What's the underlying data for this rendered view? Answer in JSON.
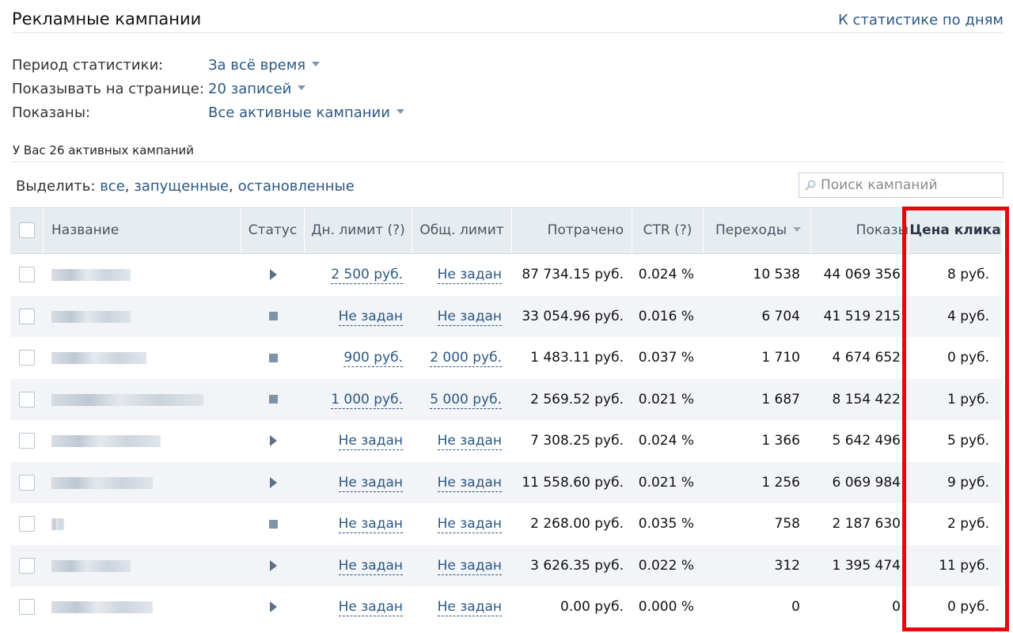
{
  "header": {
    "title": "Рекламные кампании",
    "stats_link": "К статистике по дням"
  },
  "filters": [
    {
      "label": "Период статистики:",
      "value": "За всё время"
    },
    {
      "label": "Показывать на странице:",
      "value": "20 записей"
    },
    {
      "label": "Показаны:",
      "value": "Все активные кампании"
    }
  ],
  "summary": "У Вас 26 активных кампаний",
  "selection": {
    "prefix": "Выделить:",
    "all": "все",
    "running": "запущенные",
    "stopped": "остановленные",
    "sep": ","
  },
  "search": {
    "placeholder": "Поиск кампаний"
  },
  "table": {
    "columns": {
      "name": "Название",
      "status": "Статус",
      "day_limit": "Дн. лимит (?)",
      "total_limit": "Общ. лимит",
      "spent": "Потрачено",
      "ctr": "CTR (?)",
      "clicks": "Переходы",
      "impressions": "Показы",
      "click_price": "Цена клика"
    },
    "sorted_by": "clicks",
    "rows": [
      {
        "status": "running",
        "day_limit": "2 500 руб.",
        "total_limit": "Не задан",
        "spent": "87 734.15 руб.",
        "ctr": "0.024 %",
        "clicks": "10 538",
        "impressions": "44 069 356",
        "click_price": "8 руб."
      },
      {
        "status": "stopped",
        "day_limit": "Не задан",
        "total_limit": "Не задан",
        "spent": "33 054.96 руб.",
        "ctr": "0.016 %",
        "clicks": "6 704",
        "impressions": "41 519 215",
        "click_price": "4 руб."
      },
      {
        "status": "stopped",
        "day_limit": "900 руб.",
        "total_limit": "2 000 руб.",
        "spent": "1 483.11 руб.",
        "ctr": "0.037 %",
        "clicks": "1 710",
        "impressions": "4 674 652",
        "click_price": "0 руб."
      },
      {
        "status": "stopped",
        "day_limit": "1 000 руб.",
        "total_limit": "5 000 руб.",
        "spent": "2 569.52 руб.",
        "ctr": "0.021 %",
        "clicks": "1 687",
        "impressions": "8 154 422",
        "click_price": "1 руб."
      },
      {
        "status": "running",
        "day_limit": "Не задан",
        "total_limit": "Не задан",
        "spent": "7 308.25 руб.",
        "ctr": "0.024 %",
        "clicks": "1 366",
        "impressions": "5 642 496",
        "click_price": "5 руб."
      },
      {
        "status": "running",
        "day_limit": "Не задан",
        "total_limit": "Не задан",
        "spent": "11 558.60 руб.",
        "ctr": "0.021 %",
        "clicks": "1 256",
        "impressions": "6 069 984",
        "click_price": "9 руб."
      },
      {
        "status": "stopped",
        "day_limit": "Не задан",
        "total_limit": "Не задан",
        "spent": "2 268.00 руб.",
        "ctr": "0.035 %",
        "clicks": "758",
        "impressions": "2 187 630",
        "click_price": "2 руб."
      },
      {
        "status": "running",
        "day_limit": "Не задан",
        "total_limit": "Не задан",
        "spent": "3 626.35 руб.",
        "ctr": "0.022 %",
        "clicks": "312",
        "impressions": "1 395 474",
        "click_price": "11 руб."
      },
      {
        "status": "running",
        "day_limit": "Не задан",
        "total_limit": "Не задан",
        "spent": "0.00 руб.",
        "ctr": "0.000 %",
        "clicks": "0",
        "impressions": "0",
        "click_price": "0 руб."
      }
    ]
  },
  "icons": {
    "running": "play-icon",
    "stopped": "stop-icon",
    "search": "search-icon"
  },
  "colors": {
    "link": "#2a5885",
    "highlight": "#e5090b",
    "header_bg": "#e7ecf1",
    "alt_row": "#f2f4f7"
  }
}
